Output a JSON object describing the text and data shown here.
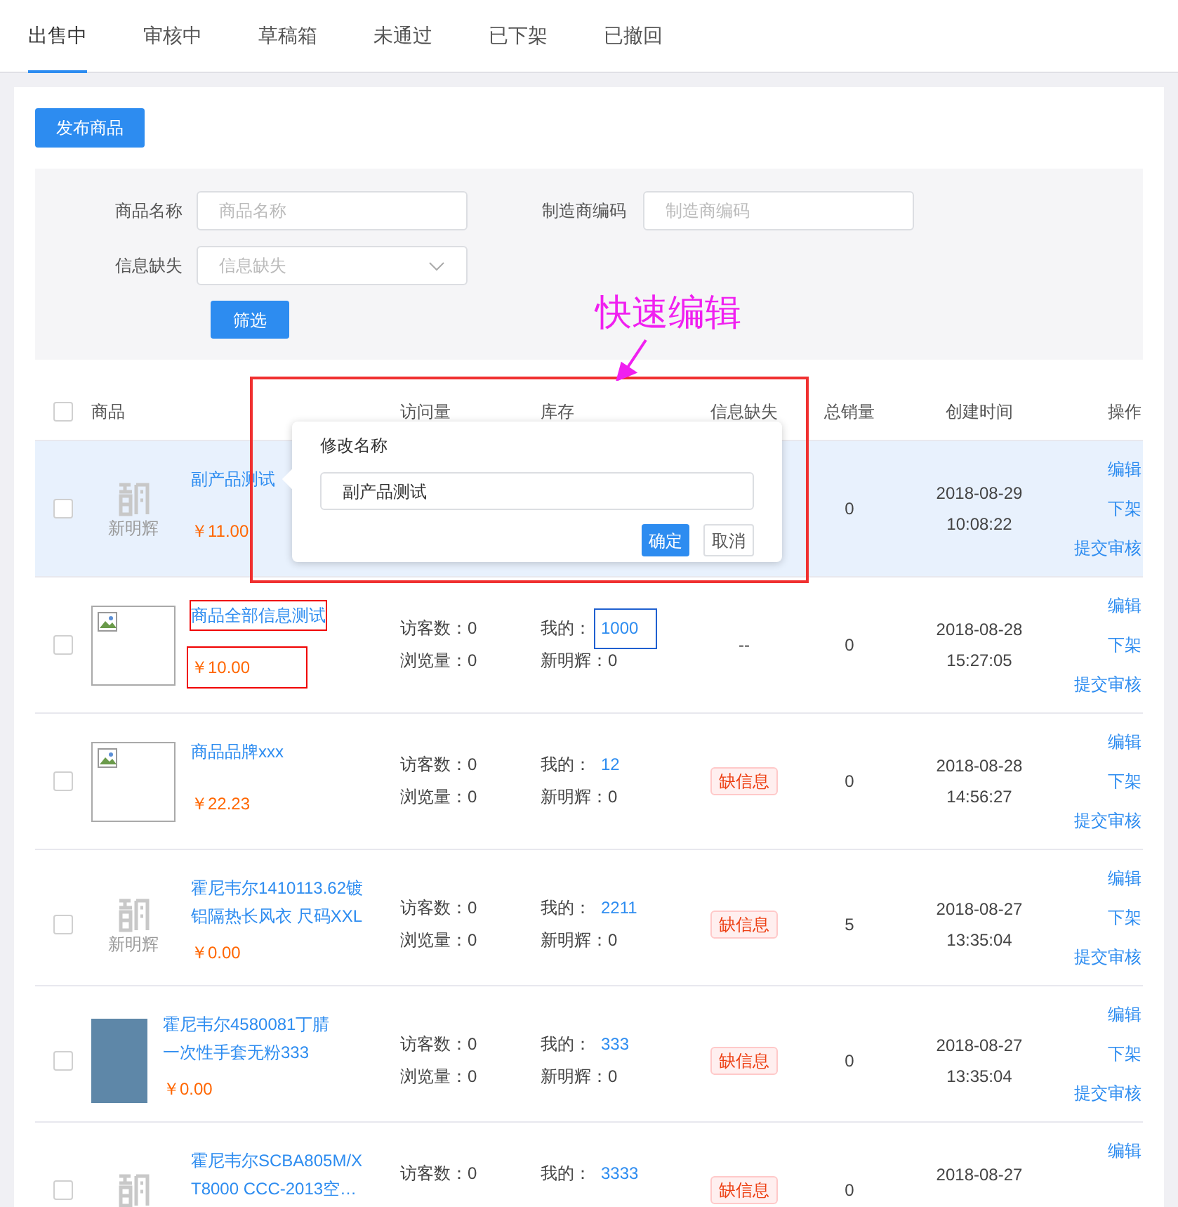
{
  "tabs": [
    {
      "label": "出售中",
      "selected": true
    },
    {
      "label": "审核中",
      "selected": false
    },
    {
      "label": "草稿箱",
      "selected": false
    },
    {
      "label": "未通过",
      "selected": false
    },
    {
      "label": "已下架",
      "selected": false
    },
    {
      "label": "已撤回",
      "selected": false
    }
  ],
  "publish_button": "发布商品",
  "filters": {
    "fields": [
      {
        "label": "商品名称",
        "placeholder": "商品名称",
        "kind": "text"
      },
      {
        "label": "制造商编码",
        "placeholder": "制造商编码",
        "kind": "text"
      },
      {
        "label": "信息缺失",
        "placeholder": "信息缺失",
        "kind": "select"
      }
    ],
    "submit": "筛选"
  },
  "table": {
    "header_checked": false,
    "columns": [
      "商品",
      "访问量",
      "库存",
      "信息缺失",
      "总销量",
      "创建时间",
      "操作"
    ],
    "rows": [
      {
        "selected": true,
        "checked": false,
        "thumbnail": {
          "kind": "logo",
          "text": "新明辉"
        },
        "name": "副产品测试",
        "price": "￥11.00",
        "sales": "0",
        "date": "2018-08-29",
        "time": "10:08:22",
        "actions": [
          "编辑",
          "下架",
          "提交审核"
        ],
        "annotated": false
      },
      {
        "selected": false,
        "checked": false,
        "thumbnail": {
          "kind": "broken"
        },
        "name": "商品全部信息测试",
        "price": "￥10.00",
        "visitors": "访客数：0",
        "views": "浏览量：0",
        "stock_label": "我的：",
        "stock": "1000",
        "stock_other": "新明辉：0",
        "missing": "--",
        "sales": "0",
        "date": "2018-08-28",
        "time": "15:27:05",
        "actions": [
          "编辑",
          "下架",
          "提交审核"
        ],
        "annotated": true
      },
      {
        "selected": false,
        "checked": false,
        "thumbnail": {
          "kind": "broken"
        },
        "name": "商品品牌xxx",
        "price": "￥22.23",
        "visitors": "访客数：0",
        "views": "浏览量：0",
        "stock_label": "我的：",
        "stock": "12",
        "stock_other": "新明辉：0",
        "missing_tag": "缺信息",
        "sales": "0",
        "date": "2018-08-28",
        "time": "14:56:27",
        "actions": [
          "编辑",
          "下架",
          "提交审核"
        ],
        "annotated": false
      },
      {
        "selected": false,
        "checked": false,
        "thumbnail": {
          "kind": "logo",
          "text": "新明辉"
        },
        "name": "霍尼韦尔1410113.62镀铝隔热长风衣 尺码XXL",
        "price": "￥0.00",
        "visitors": "访客数：0",
        "views": "浏览量：0",
        "stock_label": "我的：",
        "stock": "2211",
        "stock_other": "新明辉：0",
        "missing_tag": "缺信息",
        "sales": "5",
        "date": "2018-08-27",
        "time": "13:35:04",
        "actions": [
          "编辑",
          "下架",
          "提交审核"
        ],
        "annotated": false
      },
      {
        "selected": false,
        "checked": false,
        "thumbnail": {
          "kind": "photo"
        },
        "name": "霍尼韦尔4580081丁腈一次性手套无粉333",
        "price": "￥0.00",
        "visitors": "访客数：0",
        "views": "浏览量：0",
        "stock_label": "我的：",
        "stock": "333",
        "stock_other": "新明辉：0",
        "missing_tag": "缺信息",
        "sales": "0",
        "date": "2018-08-27",
        "time": "13:35:04",
        "actions": [
          "编辑",
          "下架",
          "提交审核"
        ],
        "annotated": false
      },
      {
        "selected": false,
        "checked": false,
        "thumbnail": {
          "kind": "logo"
        },
        "name": "霍尼韦尔SCBA805M/XT8000 CCC-2013空…",
        "visitors": "访客数：0",
        "stock_label": "我的：",
        "stock": "3333",
        "missing_tag": "缺信息",
        "sales": "0",
        "date": "2018-08-27",
        "actions": [
          "编辑"
        ],
        "annotated": false
      }
    ]
  },
  "popover": {
    "title": "修改名称",
    "value": "副产品测试",
    "confirm": "确定",
    "cancel": "取消"
  },
  "annotation": {
    "label": "快速编辑"
  }
}
